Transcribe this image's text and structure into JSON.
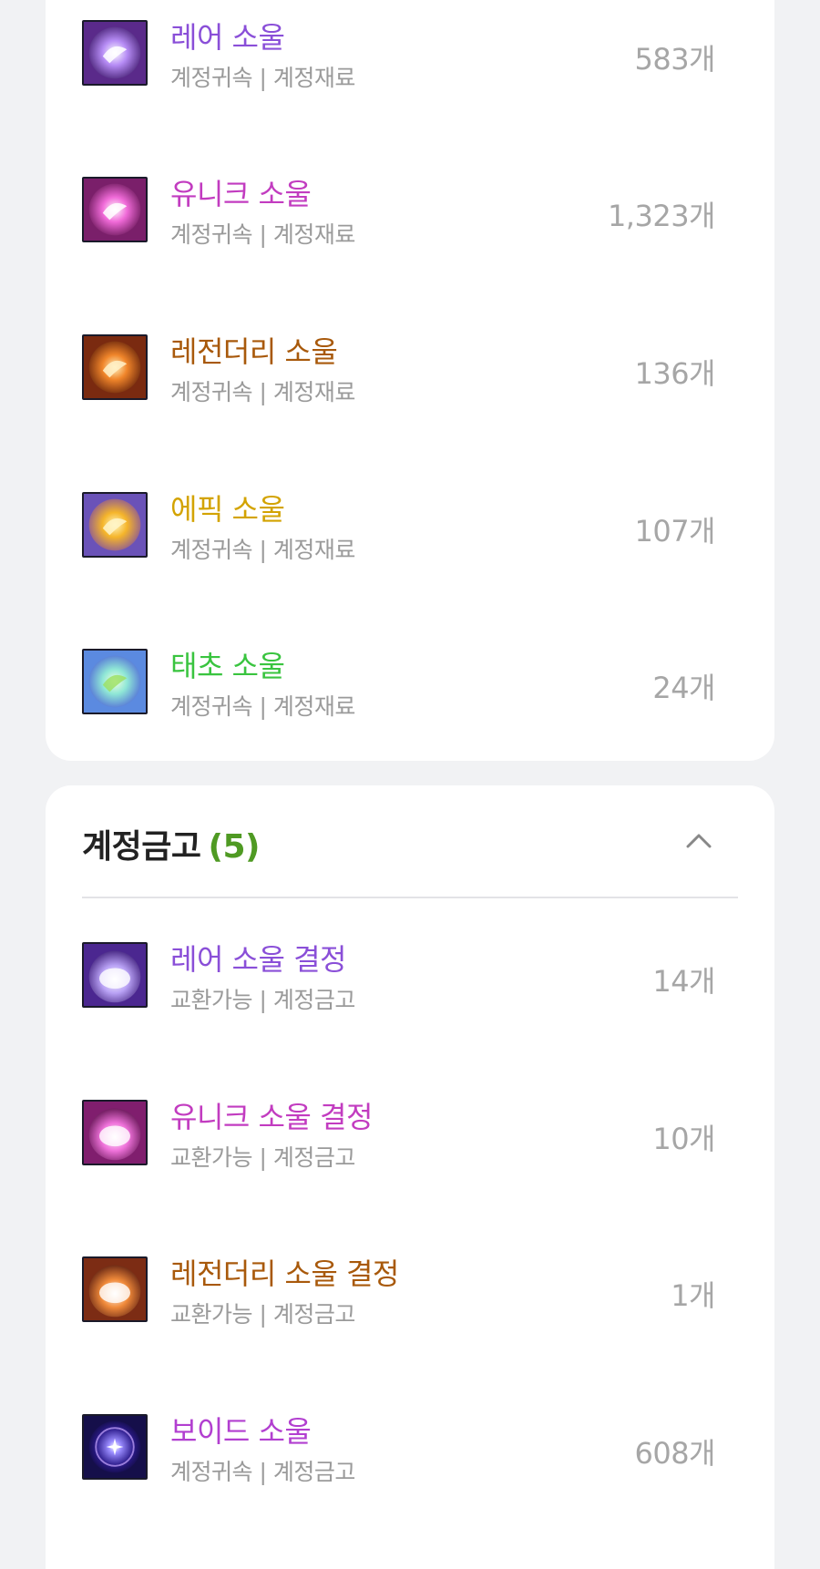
{
  "account_materials": {
    "items": [
      {
        "name": "레어 소울",
        "sub": "계정귀속 | 계정재료",
        "count": "583개",
        "color": "#8a4fd8"
      },
      {
        "name": "유니크 소울",
        "sub": "계정귀속 | 계정재료",
        "count": "1,323개",
        "color": "#c23cc0"
      },
      {
        "name": "레전더리 소울",
        "sub": "계정귀속 | 계정재료",
        "count": "136개",
        "color": "#a8590b"
      },
      {
        "name": "에픽 소울",
        "sub": "계정귀속 | 계정재료",
        "count": "107개",
        "color": "#d3a300"
      },
      {
        "name": "태초 소울",
        "sub": "계정귀속 | 계정재료",
        "count": "24개",
        "color": "#39c43f"
      }
    ]
  },
  "account_vault": {
    "title": "계정금고",
    "count": "(5)",
    "items": [
      {
        "name": "레어 소울 결정",
        "sub": "교환가능 | 계정금고",
        "count": "14개",
        "color": "#8a4fd8"
      },
      {
        "name": "유니크 소울 결정",
        "sub": "교환가능 | 계정금고",
        "count": "10개",
        "color": "#c23cc0"
      },
      {
        "name": "레전더리 소울 결정",
        "sub": "교환가능 | 계정금고",
        "count": "1개",
        "color": "#a8590b"
      },
      {
        "name": "보이드 소울",
        "sub": "계정귀속 | 계정금고",
        "count": "608개",
        "color": "#b23fd0"
      }
    ]
  },
  "icons": {
    "rare_soul": "rare-soul-icon",
    "unique_soul": "unique-soul-icon",
    "legendary_soul": "legendary-soul-icon",
    "epic_soul": "epic-soul-icon",
    "primal_soul": "primal-soul-icon",
    "rare_crystal": "rare-soul-crystal-icon",
    "unique_crystal": "unique-soul-crystal-icon",
    "legendary_crystal": "legendary-soul-crystal-icon",
    "void_soul": "void-soul-icon",
    "collapse": "chevron-up-icon"
  }
}
